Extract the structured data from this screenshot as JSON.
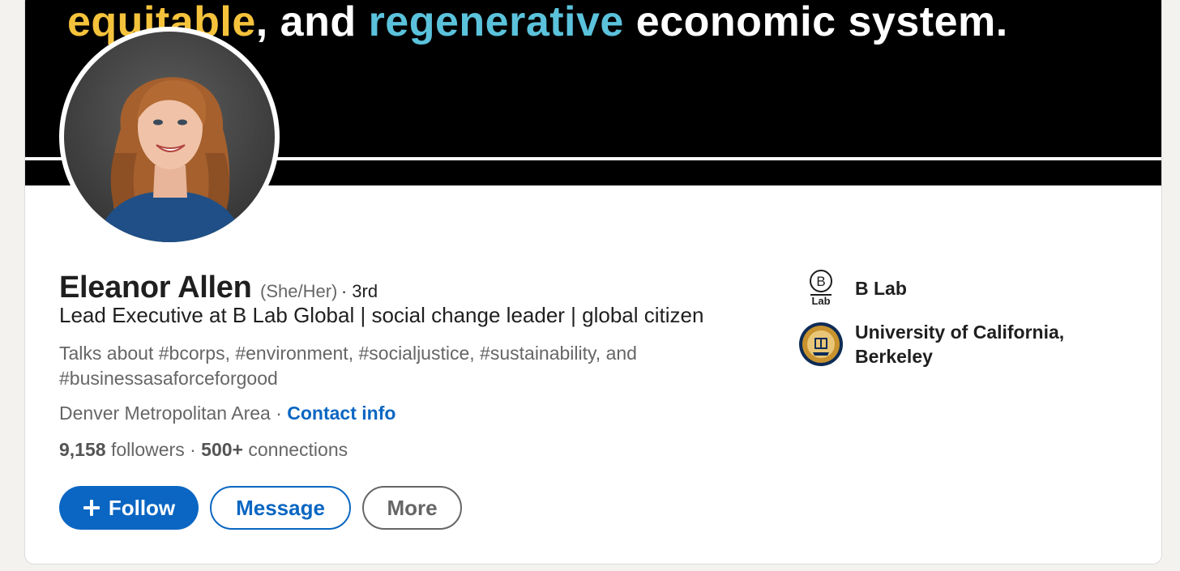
{
  "banner": {
    "word1": "equitable",
    "sep": ", and ",
    "word2": "regenerative",
    "rest": " economic system.",
    "colors": {
      "highlight_yellow": "#f5c23b",
      "highlight_blue": "#5bc2dc",
      "background": "#000000"
    }
  },
  "profile": {
    "name": "Eleanor Allen",
    "pronouns": "(She/Her)",
    "degree": " · 3rd",
    "headline": "Lead Executive at B Lab Global | social change leader | global citizen",
    "talks_about": "Talks about #bcorps, #environment, #socialjustice, #sustainability, and #businessasaforceforgood",
    "location": "Denver Metropolitan Area",
    "location_sep": " · ",
    "contact_label": "Contact info",
    "followers_count": "9,158",
    "followers_label": " followers",
    "stats_sep": " · ",
    "connections_count": "500+",
    "connections_label": " connections",
    "avatar_icon": "profile-photo"
  },
  "actions": {
    "follow_label": "Follow",
    "follow_icon": "plus-icon",
    "message_label": "Message",
    "more_label": "More"
  },
  "organizations": [
    {
      "name": "B Lab",
      "logo_text": "Lab",
      "logo_letter": "B",
      "icon": "b-lab-logo"
    },
    {
      "name": "University of California, Berkeley",
      "icon": "uc-berkeley-seal"
    }
  ],
  "colors": {
    "link": "#0a66c2",
    "text_primary": "#1f1f1f",
    "text_secondary": "#666666"
  }
}
